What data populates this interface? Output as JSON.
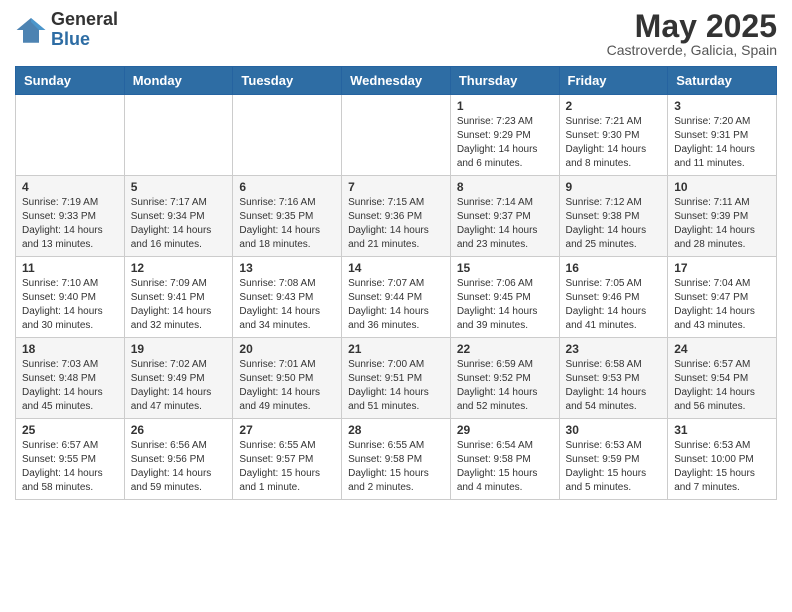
{
  "logo": {
    "general": "General",
    "blue": "Blue"
  },
  "title": "May 2025",
  "location": "Castroverde, Galicia, Spain",
  "days_of_week": [
    "Sunday",
    "Monday",
    "Tuesday",
    "Wednesday",
    "Thursday",
    "Friday",
    "Saturday"
  ],
  "weeks": [
    [
      {
        "day": "",
        "info": ""
      },
      {
        "day": "",
        "info": ""
      },
      {
        "day": "",
        "info": ""
      },
      {
        "day": "",
        "info": ""
      },
      {
        "day": "1",
        "info": "Sunrise: 7:23 AM\nSunset: 9:29 PM\nDaylight: 14 hours\nand 6 minutes."
      },
      {
        "day": "2",
        "info": "Sunrise: 7:21 AM\nSunset: 9:30 PM\nDaylight: 14 hours\nand 8 minutes."
      },
      {
        "day": "3",
        "info": "Sunrise: 7:20 AM\nSunset: 9:31 PM\nDaylight: 14 hours\nand 11 minutes."
      }
    ],
    [
      {
        "day": "4",
        "info": "Sunrise: 7:19 AM\nSunset: 9:33 PM\nDaylight: 14 hours\nand 13 minutes."
      },
      {
        "day": "5",
        "info": "Sunrise: 7:17 AM\nSunset: 9:34 PM\nDaylight: 14 hours\nand 16 minutes."
      },
      {
        "day": "6",
        "info": "Sunrise: 7:16 AM\nSunset: 9:35 PM\nDaylight: 14 hours\nand 18 minutes."
      },
      {
        "day": "7",
        "info": "Sunrise: 7:15 AM\nSunset: 9:36 PM\nDaylight: 14 hours\nand 21 minutes."
      },
      {
        "day": "8",
        "info": "Sunrise: 7:14 AM\nSunset: 9:37 PM\nDaylight: 14 hours\nand 23 minutes."
      },
      {
        "day": "9",
        "info": "Sunrise: 7:12 AM\nSunset: 9:38 PM\nDaylight: 14 hours\nand 25 minutes."
      },
      {
        "day": "10",
        "info": "Sunrise: 7:11 AM\nSunset: 9:39 PM\nDaylight: 14 hours\nand 28 minutes."
      }
    ],
    [
      {
        "day": "11",
        "info": "Sunrise: 7:10 AM\nSunset: 9:40 PM\nDaylight: 14 hours\nand 30 minutes."
      },
      {
        "day": "12",
        "info": "Sunrise: 7:09 AM\nSunset: 9:41 PM\nDaylight: 14 hours\nand 32 minutes."
      },
      {
        "day": "13",
        "info": "Sunrise: 7:08 AM\nSunset: 9:43 PM\nDaylight: 14 hours\nand 34 minutes."
      },
      {
        "day": "14",
        "info": "Sunrise: 7:07 AM\nSunset: 9:44 PM\nDaylight: 14 hours\nand 36 minutes."
      },
      {
        "day": "15",
        "info": "Sunrise: 7:06 AM\nSunset: 9:45 PM\nDaylight: 14 hours\nand 39 minutes."
      },
      {
        "day": "16",
        "info": "Sunrise: 7:05 AM\nSunset: 9:46 PM\nDaylight: 14 hours\nand 41 minutes."
      },
      {
        "day": "17",
        "info": "Sunrise: 7:04 AM\nSunset: 9:47 PM\nDaylight: 14 hours\nand 43 minutes."
      }
    ],
    [
      {
        "day": "18",
        "info": "Sunrise: 7:03 AM\nSunset: 9:48 PM\nDaylight: 14 hours\nand 45 minutes."
      },
      {
        "day": "19",
        "info": "Sunrise: 7:02 AM\nSunset: 9:49 PM\nDaylight: 14 hours\nand 47 minutes."
      },
      {
        "day": "20",
        "info": "Sunrise: 7:01 AM\nSunset: 9:50 PM\nDaylight: 14 hours\nand 49 minutes."
      },
      {
        "day": "21",
        "info": "Sunrise: 7:00 AM\nSunset: 9:51 PM\nDaylight: 14 hours\nand 51 minutes."
      },
      {
        "day": "22",
        "info": "Sunrise: 6:59 AM\nSunset: 9:52 PM\nDaylight: 14 hours\nand 52 minutes."
      },
      {
        "day": "23",
        "info": "Sunrise: 6:58 AM\nSunset: 9:53 PM\nDaylight: 14 hours\nand 54 minutes."
      },
      {
        "day": "24",
        "info": "Sunrise: 6:57 AM\nSunset: 9:54 PM\nDaylight: 14 hours\nand 56 minutes."
      }
    ],
    [
      {
        "day": "25",
        "info": "Sunrise: 6:57 AM\nSunset: 9:55 PM\nDaylight: 14 hours\nand 58 minutes."
      },
      {
        "day": "26",
        "info": "Sunrise: 6:56 AM\nSunset: 9:56 PM\nDaylight: 14 hours\nand 59 minutes."
      },
      {
        "day": "27",
        "info": "Sunrise: 6:55 AM\nSunset: 9:57 PM\nDaylight: 15 hours\nand 1 minute."
      },
      {
        "day": "28",
        "info": "Sunrise: 6:55 AM\nSunset: 9:58 PM\nDaylight: 15 hours\nand 2 minutes."
      },
      {
        "day": "29",
        "info": "Sunrise: 6:54 AM\nSunset: 9:58 PM\nDaylight: 15 hours\nand 4 minutes."
      },
      {
        "day": "30",
        "info": "Sunrise: 6:53 AM\nSunset: 9:59 PM\nDaylight: 15 hours\nand 5 minutes."
      },
      {
        "day": "31",
        "info": "Sunrise: 6:53 AM\nSunset: 10:00 PM\nDaylight: 15 hours\nand 7 minutes."
      }
    ]
  ]
}
